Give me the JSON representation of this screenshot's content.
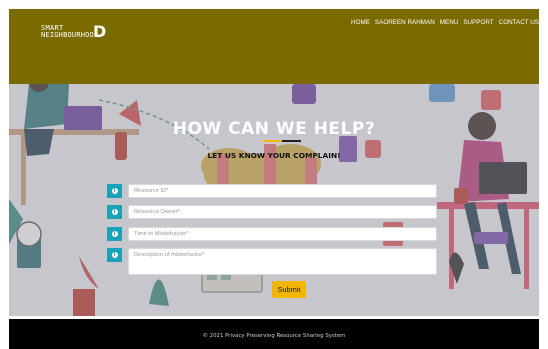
{
  "header": {
    "logo": {
      "line1": "SMART",
      "line2": "NEIGHBOURHOO",
      "end": "D"
    },
    "nav": [
      "HOME",
      "SAOREEN RAHMAN",
      "MENU",
      "SUPPORT",
      "CONTACT US"
    ]
  },
  "hero": {
    "heading": "HOW CAN WE HELP?",
    "subheading": "LET US KNOW YOUR COMPLAIN!",
    "underline_colors": [
      "#f2b600",
      "#222222"
    ],
    "fields": [
      {
        "placeholder": "Resource ID*"
      },
      {
        "placeholder": "Resource Owner*"
      },
      {
        "placeholder": "Time to Misbehavior*"
      },
      {
        "placeholder": "Description of misbehavior*"
      }
    ],
    "info_icon_glyph": "i",
    "submit_label": "Submit"
  },
  "footer": {
    "copyright": "© 2021 Privacy Preserving Resource Sharing System"
  },
  "colors": {
    "topbar": "#7a6a00",
    "accent": "#1aa3b8",
    "button": "#f2b600",
    "footer": "#000000"
  }
}
